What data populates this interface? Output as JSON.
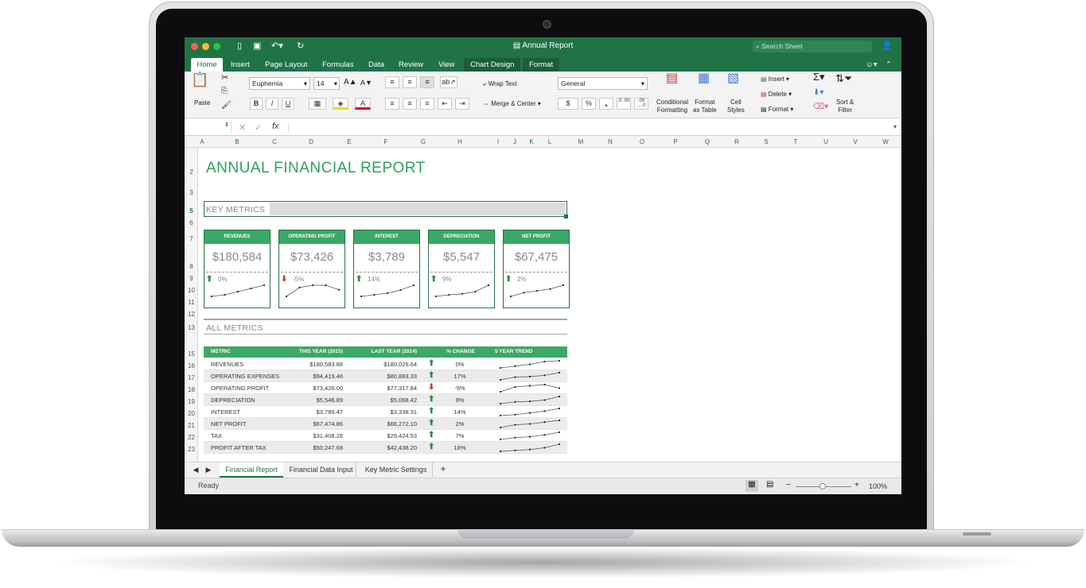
{
  "window": {
    "title": "Annual Report",
    "search_placeholder": "Search Sheet"
  },
  "tabs": [
    "Home",
    "Insert",
    "Page Layout",
    "Formulas",
    "Data",
    "Review",
    "View",
    "Chart Design",
    "Format"
  ],
  "ribbon": {
    "paste": "Paste",
    "font_name": "Euphemia",
    "font_size": "14",
    "wrap_text": "Wrap Text",
    "merge_center": "Merge & Center",
    "number_format": "General",
    "conditional_formatting": [
      "Conditional",
      "Formatting"
    ],
    "format_as_table": [
      "Format",
      "as Table"
    ],
    "cell_styles": [
      "Cell",
      "Styles"
    ],
    "insert": "Insert",
    "delete": "Delete",
    "format": "Format",
    "sort_filter": [
      "Sort &",
      "Filter"
    ],
    "bold": "B",
    "italic": "I",
    "underline": "U",
    "grow_font": "A▲",
    "shrink_font": "A▼",
    "percent": "%",
    "currency": "$",
    "comma": "❟",
    "inc_decimal": ".0\n.00",
    "dec_decimal": ".00\n→.0"
  },
  "formula_bar": {
    "fx": "fx",
    "value": ""
  },
  "columns": [
    "A",
    "B",
    "C",
    "D",
    "E",
    "F",
    "G",
    "H",
    "I",
    "J",
    "K",
    "L",
    "M",
    "N",
    "O",
    "P",
    "Q",
    "R",
    "S",
    "T",
    "U",
    "V",
    "W"
  ],
  "rows": [
    "2",
    "3",
    "5",
    "6",
    "7",
    "8",
    "9",
    "10",
    "11",
    "12",
    "13",
    "15",
    "16",
    "17",
    "18",
    "19",
    "20",
    "21",
    "22",
    "23"
  ],
  "report": {
    "heading": "ANNUAL FINANCIAL REPORT",
    "key_metrics_label": "KEY METRICS",
    "all_metrics_label": "ALL METRICS"
  },
  "key_metrics": [
    {
      "name": "REVENUES",
      "value": "$180,584",
      "pct": "0%",
      "dir": "up",
      "trend": [
        3,
        3.5,
        4.5,
        5.5,
        6.5
      ]
    },
    {
      "name": "OPERATING PROFIT",
      "value": "$73,426",
      "pct": "-5%",
      "dir": "down",
      "trend": [
        3,
        5,
        5.5,
        5.5,
        4.5
      ]
    },
    {
      "name": "INTEREST",
      "value": "$3,789",
      "pct": "14%",
      "dir": "up",
      "trend": [
        3,
        3.5,
        4,
        5,
        6.5
      ]
    },
    {
      "name": "DEPRECIATION",
      "value": "$5,547",
      "pct": "9%",
      "dir": "up",
      "trend": [
        3,
        3.5,
        3.8,
        4.5,
        6.5
      ]
    },
    {
      "name": "NET PROFIT",
      "value": "$67,475",
      "pct": "2%",
      "dir": "up",
      "trend": [
        3,
        4,
        4.5,
        5,
        6
      ]
    }
  ],
  "table": {
    "headers": [
      "METRIC",
      "THIS YEAR (2015)",
      "LAST YEAR (2014)",
      "% CHANGE",
      "5 YEAR TREND"
    ],
    "rows": [
      {
        "metric": "REVENUES",
        "this": "$180,583.88",
        "last": "$180,026.64",
        "dir": "up",
        "pct": "0%",
        "trend": [
          2,
          3,
          4,
          5.5,
          6
        ]
      },
      {
        "metric": "OPERATING EXPENSES",
        "this": "$94,419.46",
        "last": "$80,883.33",
        "dir": "up",
        "pct": "17%",
        "trend": [
          2,
          3.5,
          3.8,
          4.5,
          6
        ]
      },
      {
        "metric": "OPERATING PROFIT",
        "this": "$73,426.00",
        "last": "$77,317.84",
        "dir": "down",
        "pct": "-5%",
        "trend": [
          2,
          4,
          4.5,
          5,
          3.5
        ]
      },
      {
        "metric": "DEPRECIATION",
        "this": "$5,546.89",
        "last": "$5,068.42",
        "dir": "up",
        "pct": "9%",
        "trend": [
          2,
          3,
          3.3,
          4,
          6
        ]
      },
      {
        "metric": "INTEREST",
        "this": "$3,789.47",
        "last": "$3,338.31",
        "dir": "up",
        "pct": "14%",
        "trend": [
          2,
          2.5,
          3.5,
          4.5,
          6
        ]
      },
      {
        "metric": "NET PROFIT",
        "this": "$67,474.86",
        "last": "$66,272.10",
        "dir": "up",
        "pct": "2%",
        "trend": [
          2,
          3.5,
          4,
          5,
          6
        ]
      },
      {
        "metric": "TAX",
        "this": "$31,408.26",
        "last": "$29,424.53",
        "dir": "up",
        "pct": "7%",
        "trend": [
          2,
          3,
          3.5,
          4.5,
          6
        ]
      },
      {
        "metric": "PROFIT AFTER TAX",
        "this": "$50,247.68",
        "last": "$42,438.20",
        "dir": "up",
        "pct": "18%",
        "trend": [
          2,
          2.5,
          3,
          4,
          6
        ]
      }
    ]
  },
  "sheets": [
    "Financial Report",
    "Financial Data Input",
    "Key Metric Settings"
  ],
  "status": {
    "ready": "Ready",
    "zoom": "100%",
    "minus": "−",
    "plus": "+"
  },
  "colors": {
    "accent": "#217346",
    "green": "#3ba865",
    "up": "#2e8b44",
    "down": "#d33"
  }
}
